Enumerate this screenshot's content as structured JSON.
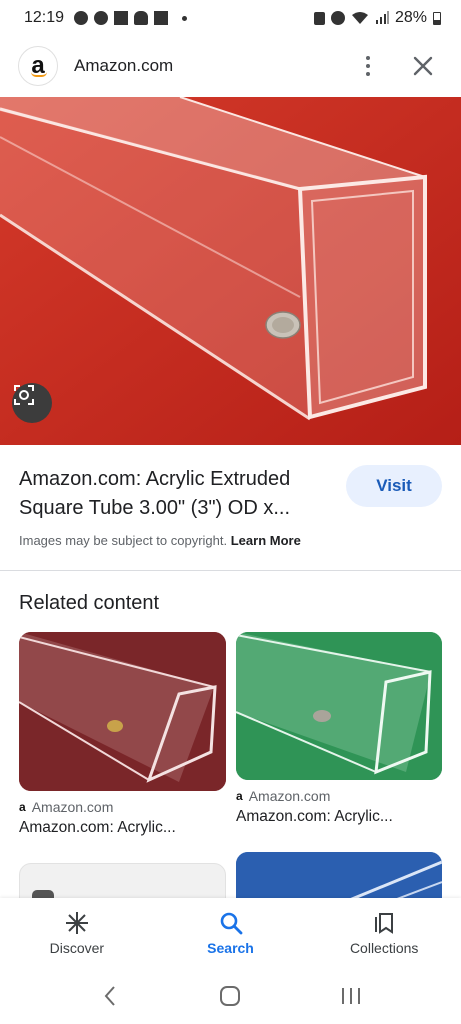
{
  "status_bar": {
    "time": "12:19",
    "battery": "28%"
  },
  "header": {
    "site_name": "Amazon.com",
    "logo_letter": "a"
  },
  "result": {
    "title": "Amazon.com: Acrylic Extruded Square Tube 3.00\" (3\") OD x...",
    "visit_label": "Visit",
    "copyright_text": "Images may be subject to copyright.",
    "learn_more": "Learn More"
  },
  "related": {
    "heading": "Related content",
    "cards": [
      {
        "source": "Amazon.com",
        "title": "Amazon.com: Acrylic..."
      },
      {
        "source": "Amazon.com",
        "title": "Amazon.com: Acrylic..."
      }
    ]
  },
  "bottom_nav": {
    "items": [
      {
        "label": "Discover",
        "icon": "asterisk-icon"
      },
      {
        "label": "Search",
        "icon": "search-icon"
      },
      {
        "label": "Collections",
        "icon": "collections-icon"
      }
    ],
    "active": "Search"
  },
  "colors": {
    "accent": "#1a73e8",
    "visit_bg": "#e8f0fe",
    "main_image_bg": "#c8291e"
  }
}
